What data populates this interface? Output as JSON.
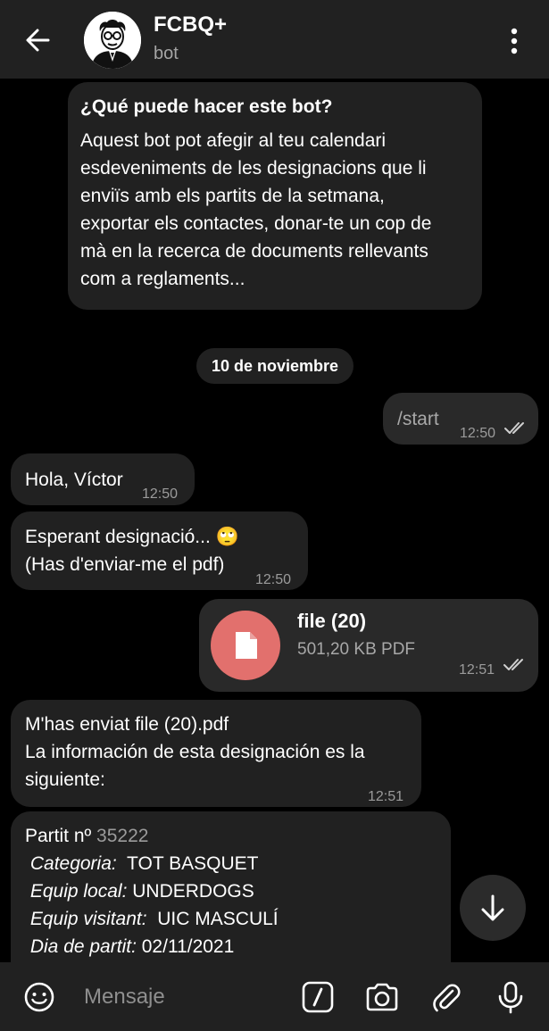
{
  "header": {
    "title": "FCBQ+",
    "subtitle": "bot",
    "back_icon": "arrow-left-icon",
    "menu_icon": "more-vert-icon"
  },
  "intro": {
    "title": "¿Qué puede hacer este bot?",
    "lines": [
      "Aquest bot pot afegir al teu calendari",
      "esdeveniments de les designacions que li",
      "enviïs amb els partits de la setmana,",
      "exportar els contactes, donar-te un cop de",
      "mà en la recerca de documents rellevants",
      "com a reglaments..."
    ]
  },
  "date_separator": "10 de noviembre",
  "messages": {
    "start": {
      "text": "/start",
      "time": "12:50"
    },
    "hola": {
      "text": "Hola, Víctor",
      "time": "12:50"
    },
    "esperant": {
      "line1": "Esperant designació... 🙄",
      "line2": "(Has d'enviar-me el pdf)",
      "time": "12:50"
    },
    "file": {
      "name": "file (20)",
      "size": "501,20 KB PDF",
      "time": "12:51",
      "icon": "document-icon"
    },
    "enviat": {
      "line1": "M'has enviat file (20).pdf",
      "line2": "La información de esta designación es la",
      "line3": "siguiente:",
      "time": "12:51"
    },
    "partit": {
      "label": "Partit nº",
      "number": "35222",
      "categoria_label": "Categoria:",
      "categoria": "TOT BASQUET",
      "local_label": "Equip local:",
      "local": "UNDERDOGS",
      "visitant_label": "Equip visitant:",
      "visitant": "UIC MASCULÍ",
      "dia_label": "Dia de partit:",
      "dia": "02/11/2021"
    }
  },
  "input": {
    "placeholder": "Mensaje",
    "icons": [
      "emoji-icon",
      "command-icon",
      "camera-icon",
      "attach-icon",
      "mic-icon"
    ]
  },
  "colors": {
    "background": "#000000",
    "bar": "#212121",
    "bubble": "#212121",
    "file_accent": "#e2706d"
  }
}
